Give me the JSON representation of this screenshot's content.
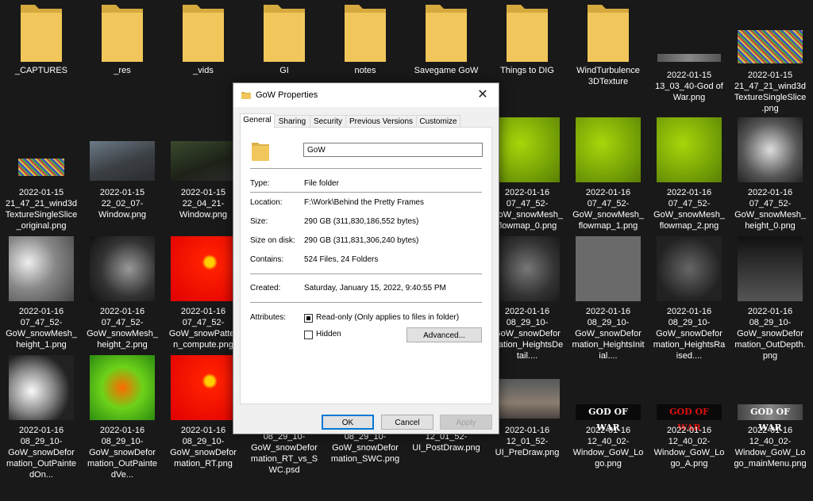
{
  "desktop": {
    "items": [
      {
        "caption": "_CAPTURES",
        "kind": "folder"
      },
      {
        "caption": "_res",
        "kind": "folder"
      },
      {
        "caption": "_vids",
        "kind": "folder"
      },
      {
        "caption": "GI",
        "kind": "folder"
      },
      {
        "caption": "notes",
        "kind": "folder"
      },
      {
        "caption": "Savegame GoW",
        "kind": "folder"
      },
      {
        "caption": "Things to DIG",
        "kind": "folder"
      },
      {
        "caption": "WindTurbulence 3DTexture",
        "kind": "folder"
      },
      {
        "caption": "2022-01-15 13_03_40-God of War.png",
        "kind": "image"
      },
      {
        "caption": "2022-01-15 21_47_21_wind3d TextureSingleSlice.png",
        "kind": "image"
      },
      {
        "caption": "2022-01-15 21_47_21_wind3d TextureSingleSlice_original.png",
        "kind": "image"
      },
      {
        "caption": "2022-01-15 22_02_07-Window.png",
        "kind": "image"
      },
      {
        "caption": "2022-01-15 22_04_21-Window.png",
        "kind": "image"
      },
      {
        "caption": "2022-01-16 07_47_52-GoW_snowMesh_flowmap_0.png",
        "kind": "image"
      },
      {
        "caption": "2022-01-16 07_47_52-GoW_snowMesh_flowmap_1.png",
        "kind": "image"
      },
      {
        "caption": "2022-01-16 07_47_52-GoW_snowMesh_flowmap_2.png",
        "kind": "image"
      },
      {
        "caption": "2022-01-16 07_47_52-GoW_snowMesh_height_0.png",
        "kind": "image"
      },
      {
        "caption": "2022-01-16 07_47_52-GoW_snowMesh_height_1.png",
        "kind": "image"
      },
      {
        "caption": "2022-01-16 07_47_52-GoW_snowMesh_height_2.png",
        "kind": "image"
      },
      {
        "caption": "2022-01-16 07_47_52-GoW_snowPattern_compute.png",
        "kind": "image"
      },
      {
        "caption": "2022-01-16 08_29_10-GoW_snowDeformation_HeightsDetail....",
        "kind": "image"
      },
      {
        "caption": "2022-01-16 08_29_10-GoW_snowDeformation_HeightsInitial....",
        "kind": "image"
      },
      {
        "caption": "2022-01-16 08_29_10-GoW_snowDeformation_HeightsRaised....",
        "kind": "image"
      },
      {
        "caption": "2022-01-16 08_29_10-GoW_snowDeformation_OutDepth.png",
        "kind": "image"
      },
      {
        "caption": "2022-01-16 08_29_10-GoW_snowDeformation_OutPaintedOn...",
        "kind": "image"
      },
      {
        "caption": "2022-01-16 08_29_10-GoW_snowDeformation_OutPaintedVe...",
        "kind": "image"
      },
      {
        "caption": "2022-01-16 08_29_10-GoW_snowDeformation_RT.png",
        "kind": "image"
      },
      {
        "caption": "08_29_10-GoW_snowDeformation_RT_vs_SWC.psd",
        "kind": "image"
      },
      {
        "caption": "08_29_10-GoW_snowDeformation_SWC.png",
        "kind": "image"
      },
      {
        "caption": "12_01_52-UI_PostDraw.png",
        "kind": "image"
      },
      {
        "caption": "2022-01-16 12_01_52-UI_PreDraw.png",
        "kind": "image"
      },
      {
        "caption": "2022-01-16 12_40_02-Window_GoW_Logo.png",
        "kind": "image"
      },
      {
        "caption": "2022-01-16 12_40_02-Window_GoW_Logo_A.png",
        "kind": "image"
      },
      {
        "caption": "2022-01-16 12_40_02-Window_GoW_Logo_mainMenu.png",
        "kind": "image"
      }
    ],
    "logo_text": "GOD OF WAR"
  },
  "dialog": {
    "title": "GoW Properties",
    "close_glyph": "✕",
    "tabs": [
      "General",
      "Sharing",
      "Security",
      "Previous Versions",
      "Customize"
    ],
    "active_tab": "General",
    "name": "GoW",
    "fields": {
      "type_label": "Type:",
      "type_value": "File folder",
      "location_label": "Location:",
      "location_value": "F:\\Work\\Behind the Pretty Frames",
      "size_label": "Size:",
      "size_value": "290 GB (311,830,186,552 bytes)",
      "size_on_disk_label": "Size on disk:",
      "size_on_disk_value": "290 GB (311,831,306,240 bytes)",
      "contains_label": "Contains:",
      "contains_value": "524 Files, 24 Folders",
      "created_label": "Created:",
      "created_value": "Saturday, January 15, 2022, 9:40:55 PM",
      "attributes_label": "Attributes:"
    },
    "readonly_label": "Read-only (Only applies to files in folder)",
    "readonly_state": "mixed",
    "hidden_label": "Hidden",
    "hidden_checked": false,
    "advanced_label": "Advanced...",
    "ok_label": "OK",
    "cancel_label": "Cancel",
    "apply_label": "Apply"
  },
  "colors": {
    "desktop_bg": "#191919",
    "folder": "#f1c75b",
    "dialog_bg": "#f0f0f0",
    "accent": "#0078d7"
  }
}
